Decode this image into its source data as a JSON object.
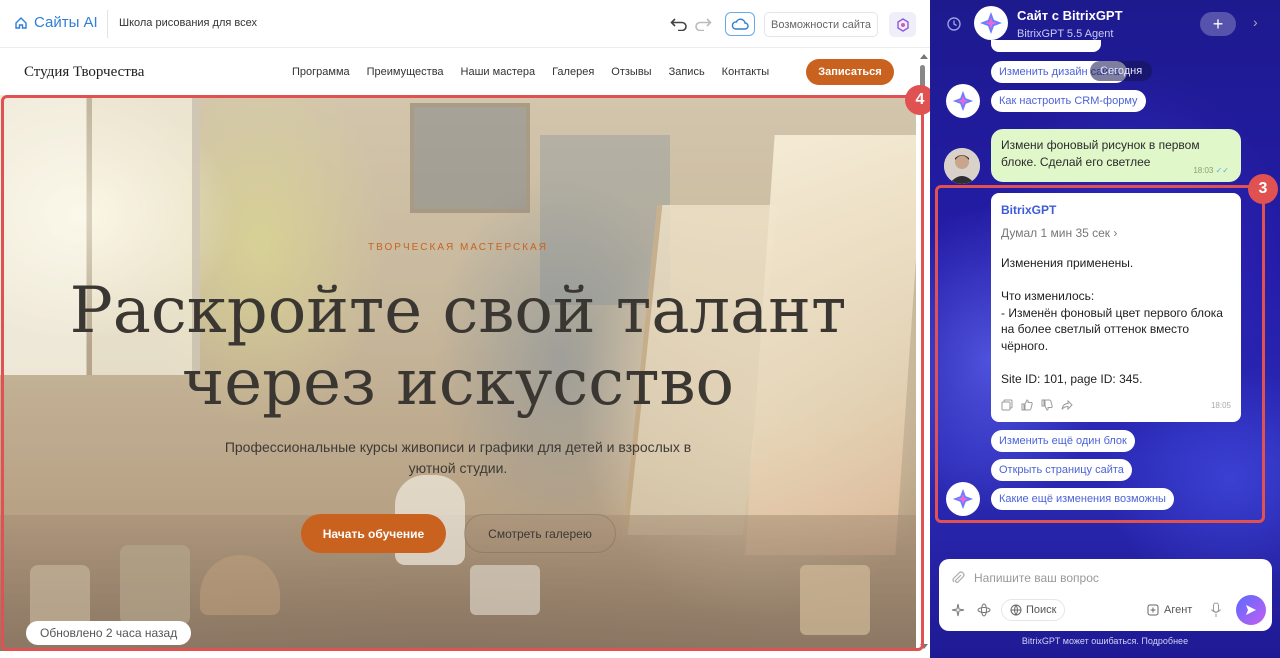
{
  "editor": {
    "brand": "Сайты AI",
    "site_name": "Школа рисования для всех",
    "features_label": "Возможности сайта"
  },
  "site": {
    "logo": "Студия Творчества",
    "nav": [
      "Программа",
      "Преимущества",
      "Наши мастера",
      "Галерея",
      "Отзывы",
      "Запись",
      "Контакты"
    ],
    "signup_label": "Записаться",
    "eyebrow": "ТВОРЧЕСКАЯ МАСТЕРСКАЯ",
    "hero_title": "Раскройте свой талант через искусство",
    "hero_sub": "Профессиональные курсы живописи и графики для детей и взрослых в уютной студии.",
    "start_label": "Начать обучение",
    "gallery_label": "Смотреть галерею",
    "updated_badge": "Обновлено 2 часа назад",
    "accent_color": "#c9621f"
  },
  "markers": {
    "hero": "4",
    "chat": "3"
  },
  "chat": {
    "title": "Сайт с BitrixGPT",
    "subtitle": "BitrixGPT 5.5 Agent",
    "today": "Сегодня",
    "prev_suggestions": [
      "Изменить дизайн сайта",
      "Как настроить CRM-форму"
    ],
    "user_message": "Измени фоновый рисунок в первом блоке. Сделай его светлее",
    "user_time": "18:03",
    "bot_name": "BitrixGPT",
    "thought": "Думал 1 мин 35 сек",
    "bot_text": "Изменения применены.\n\nЧто изменилось:\n- Изменён фоновый цвет первого блока на более светлый оттенок вместо чёрного.\n\nSite ID: 101, page ID: 345.",
    "bot_time": "18:05",
    "suggestions": [
      "Изменить ещё один блок",
      "Открыть страницу сайта",
      "Какие ещё изменения возможны"
    ],
    "input_placeholder": "Напишите ваш вопрос",
    "search_label": "Поиск",
    "agent_label": "Агент",
    "disclaimer": "BitrixGPT может ошибаться. Подробнее"
  }
}
